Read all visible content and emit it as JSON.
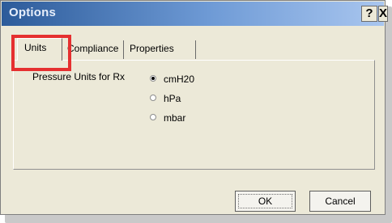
{
  "window": {
    "title": "Options",
    "help_symbol": "?",
    "close_symbol": "X"
  },
  "tabs": [
    {
      "label": "Units",
      "selected": true
    },
    {
      "label": "Compliance",
      "selected": false
    },
    {
      "label": "Properties",
      "selected": false
    }
  ],
  "units_panel": {
    "field_label": "Pressure Units for Rx",
    "options": [
      {
        "label": "cmH20",
        "selected": true
      },
      {
        "label": "hPa",
        "selected": false
      },
      {
        "label": "mbar",
        "selected": false
      }
    ]
  },
  "buttons": {
    "ok": "OK",
    "cancel": "Cancel"
  },
  "colors": {
    "highlight": "#e53030",
    "titlebar_start": "#2c5b9a",
    "titlebar_end": "#a9c6ef",
    "dialog_background": "#ece9d8"
  },
  "icons": {
    "help": "help-icon",
    "close": "close-icon",
    "radio_selected": "radio-selected-icon",
    "radio_unselected": "radio-unselected-icon"
  }
}
